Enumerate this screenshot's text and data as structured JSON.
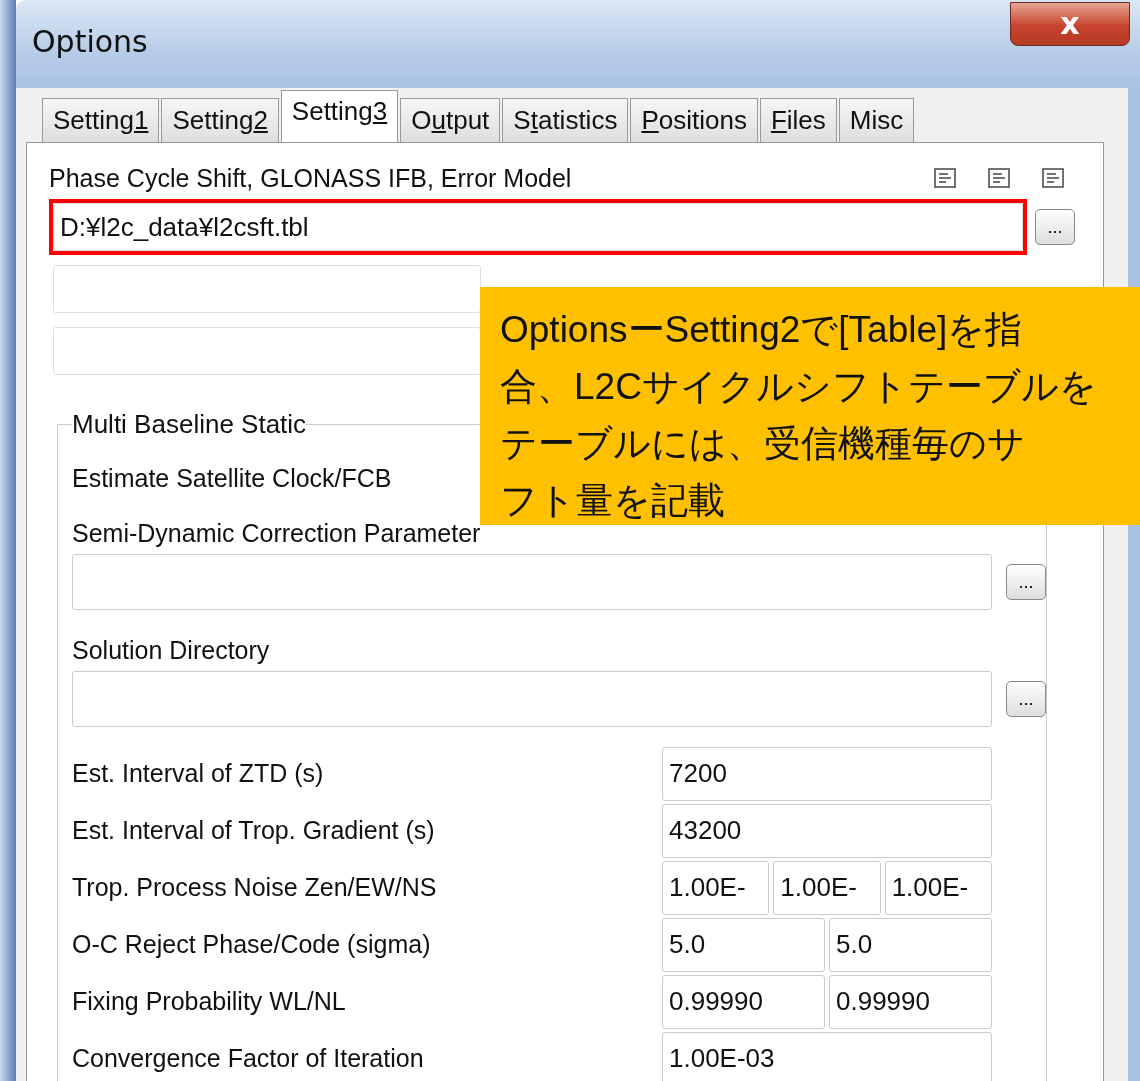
{
  "window": {
    "title": "Options",
    "close_label": "x"
  },
  "tabs": [
    {
      "before": "Setting",
      "access_key": "1",
      "selected": false
    },
    {
      "before": "Setting",
      "access_key": "2",
      "selected": false
    },
    {
      "before": "Setting",
      "access_key": "3",
      "selected": true
    },
    {
      "before": "O",
      "access_key": "u",
      "after": "tput",
      "selected": false
    },
    {
      "before": "S",
      "access_key": "t",
      "after": "atistics",
      "selected": false
    },
    {
      "access_key": "P",
      "after": "ositions",
      "selected": false
    },
    {
      "access_key": "F",
      "after": "iles",
      "selected": false
    },
    {
      "before": "Misc",
      "selected": false
    }
  ],
  "phase_section": {
    "label": "Phase Cycle Shift, GLONASS IFB, Error Model",
    "browse_label": "...",
    "fields": [
      {
        "value": "D:¥l2c_data¥l2csft.tbl",
        "highlighted": true
      },
      {
        "highlighted": false
      },
      {
        "highlighted": false
      }
    ]
  },
  "group": {
    "title": "Multi Baseline Static",
    "estimate_label": "Estimate Satellite Clock/FCB",
    "path_fields": [
      {
        "label": "Semi-Dynamic Correction Parameter",
        "browse_label": "..."
      },
      {
        "label": "Solution Directory",
        "browse_label": "..."
      }
    ],
    "rows": [
      {
        "label": "Est. Interval of ZTD (s)",
        "values": [
          "7200"
        ]
      },
      {
        "label": "Est. Interval of Trop. Gradient (s)",
        "values": [
          "43200"
        ]
      },
      {
        "label": "Trop. Process Noise Zen/EW/NS",
        "values": [
          "1.00E-",
          "1.00E-",
          "1.00E-"
        ]
      },
      {
        "label": "O-C Reject Phase/Code (sigma)",
        "values": [
          "5.0",
          "5.0"
        ]
      },
      {
        "label": "Fixing Probability WL/NL",
        "values": [
          "0.99990",
          "0.99990"
        ]
      },
      {
        "label": "Convergence Factor of Iteration",
        "values": [
          "1.00E-03"
        ]
      }
    ]
  },
  "callout": {
    "lines": [
      "OptionsーSetting2で[Table]を指",
      "合、L2Cサイクルシフトテーブルを",
      "テーブルには、受信機種毎のサ",
      "フト量を記載"
    ]
  }
}
